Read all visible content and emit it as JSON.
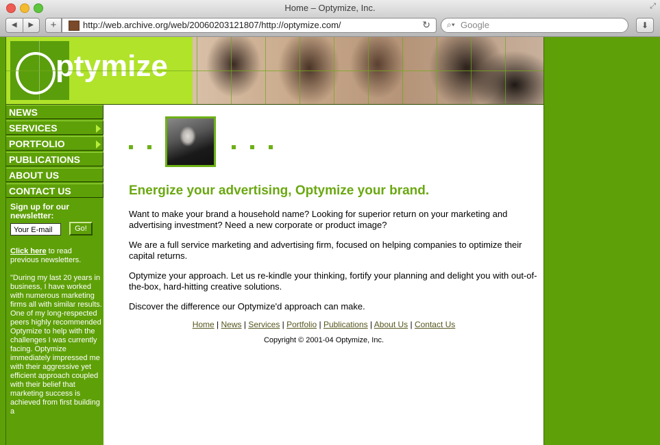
{
  "window": {
    "title": "Home – Optymize, Inc.",
    "url": "http://web.archive.org/web/20060203121807/http://optymize.com/",
    "search_placeholder": "Google"
  },
  "site": {
    "logo_text": "ptymize",
    "nav": [
      {
        "label": "NEWS",
        "has_arrow": false
      },
      {
        "label": "SERVICES",
        "has_arrow": true
      },
      {
        "label": "PORTFOLIO",
        "has_arrow": true
      },
      {
        "label": "PUBLICATIONS",
        "has_arrow": false
      },
      {
        "label": "ABOUT US",
        "has_arrow": false
      },
      {
        "label": "CONTACT US",
        "has_arrow": false
      }
    ],
    "newsletter": {
      "heading": "Sign up for our newsletter:",
      "email_value": "Your E-mail",
      "go_label": "Go!",
      "click_here": "Click here",
      "click_here_rest": " to read previous newsletters."
    },
    "testimonial": "\"During my last 20 years in business, I have worked with numerous marketing firms all with similar results. One of my long-respected peers highly recommended Optymize to help with the challenges I was currently facing. Optymize immediately impressed me with their aggressive yet efficient approach coupled with their belief that marketing success is achieved from first building a",
    "headline": "Energize your advertising, Optymize your brand.",
    "paragraphs": [
      "Want to make your brand a household name? Looking for superior return on your marketing and advertising investment? Need a new corporate or product image?",
      "We are a full service marketing and advertising firm, focused on helping companies to optimize their capital returns.",
      "Optymize your approach. Let us re-kindle your thinking, fortify your planning and delight you with out-of-the-box, hard-hitting creative solutions.",
      "Discover the difference our Optymize'd approach can make."
    ],
    "footer_links": [
      "Home",
      "News",
      "Services",
      "Portfolio",
      "Publications",
      "About Us",
      "Contact Us"
    ],
    "copyright": "Copyright © 2001-04 Optymize, Inc."
  },
  "colors": {
    "brand_green": "#5ea008",
    "logo_green": "#b0e32a",
    "headline_green": "#6aa811"
  }
}
